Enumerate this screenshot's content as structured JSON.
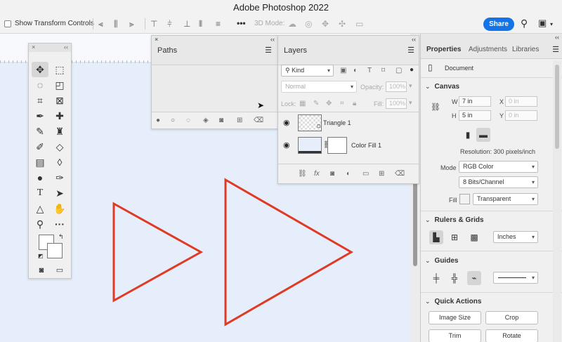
{
  "app": {
    "title": "Adobe Photoshop 2022"
  },
  "options_bar": {
    "show_transform_label": "Show Transform Controls",
    "three_d_mode_label": "3D Mode:",
    "more_label": "•••",
    "share_label": "Share"
  },
  "paths_panel": {
    "tab": "Paths",
    "close": "×",
    "collapse": "‹‹"
  },
  "layers_panel": {
    "tab": "Layers",
    "filter": "Kind",
    "blend_mode": "Normal",
    "opacity_label": "Opacity:",
    "opacity_value": "100%",
    "lock_label": "Lock:",
    "fill_label": "Fill:",
    "fill_value": "100%",
    "layers": [
      {
        "name": "Triangle 1"
      },
      {
        "name": "Color Fill 1"
      }
    ]
  },
  "properties": {
    "tabs": [
      "Properties",
      "Adjustments",
      "Libraries"
    ],
    "doc_label": "Document",
    "canvas": {
      "title": "Canvas",
      "w_label": "W",
      "w_value": "7 in",
      "h_label": "H",
      "h_value": "5 in",
      "x_label": "X",
      "x_value": "0 in",
      "y_label": "Y",
      "y_value": "0 in",
      "resolution": "Resolution: 300 pixels/inch",
      "mode_label": "Mode",
      "mode_value": "RGB Color",
      "depth_value": "8 Bits/Channel",
      "fill_label": "Fill",
      "fill_value": "Transparent"
    },
    "rulers": {
      "title": "Rulers & Grids",
      "units": "Inches"
    },
    "guides": {
      "title": "Guides"
    },
    "quick_actions": {
      "title": "Quick Actions",
      "image_size": "Image Size",
      "crop": "Crop",
      "trim": "Trim",
      "rotate": "Rotate"
    }
  },
  "colors": {
    "triangle_stroke": "#e03a24",
    "share_bg": "#1473e6",
    "canvas_bg": "#e5eefa"
  }
}
